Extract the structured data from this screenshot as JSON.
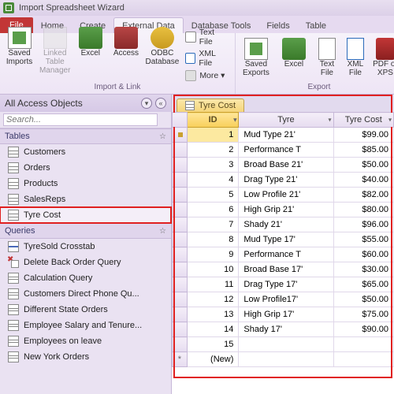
{
  "title": "Import Spreadsheet Wizard",
  "tabs": {
    "file": "File",
    "home": "Home",
    "create": "Create",
    "external": "External Data",
    "dbtools": "Database Tools",
    "fields": "Fields",
    "table": "Table"
  },
  "ribbon": {
    "import_group_label": "Import & Link",
    "export_group_label": "Export",
    "saved_imports": "Saved\nImports",
    "linked_mgr": "Linked Table\nManager",
    "excel": "Excel",
    "access": "Access",
    "odbc": "ODBC\nDatabase",
    "textfile": "Text File",
    "xmlfile": "XML File",
    "more": "More ▾",
    "saved_exports": "Saved\nExports",
    "excel2": "Excel",
    "textfile2": "Text\nFile",
    "xmlfile2": "XML\nFile",
    "pdfxps": "PDF\nor XPS"
  },
  "nav": {
    "header": "All Access Objects",
    "search_ph": "Search...",
    "tables_label": "Tables",
    "queries_label": "Queries",
    "tables": [
      "Customers",
      "Orders",
      "Products",
      "SalesReps",
      "Tyre Cost"
    ],
    "queries": [
      "TyreSold Crosstab",
      "Delete Back Order Query",
      "Calculation Query",
      "Customers Direct Phone Qu...",
      "Different State Orders",
      "Employee Salary and Tenure...",
      "Employees on leave",
      "New York Orders"
    ]
  },
  "datasheet": {
    "tab_label": "Tyre Cost",
    "cols": {
      "id": "ID",
      "tyre": "Tyre",
      "cost": "Tyre Cost"
    },
    "rows": [
      {
        "id": 1,
        "tyre": "Mud Type 21'",
        "cost": "$99.00"
      },
      {
        "id": 2,
        "tyre": "Performance T",
        "cost": "$85.00"
      },
      {
        "id": 3,
        "tyre": "Broad Base 21'",
        "cost": "$50.00"
      },
      {
        "id": 4,
        "tyre": "Drag Type 21'",
        "cost": "$40.00"
      },
      {
        "id": 5,
        "tyre": "Low Profile 21'",
        "cost": "$82.00"
      },
      {
        "id": 6,
        "tyre": "High Grip 21'",
        "cost": "$80.00"
      },
      {
        "id": 7,
        "tyre": "Shady 21'",
        "cost": "$96.00"
      },
      {
        "id": 8,
        "tyre": "Mud Type 17'",
        "cost": "$55.00"
      },
      {
        "id": 9,
        "tyre": "Performance T",
        "cost": "$60.00"
      },
      {
        "id": 10,
        "tyre": "Broad Base 17'",
        "cost": "$30.00"
      },
      {
        "id": 11,
        "tyre": "Drag Type 17'",
        "cost": "$65.00"
      },
      {
        "id": 12,
        "tyre": "Low Profile17'",
        "cost": "$50.00"
      },
      {
        "id": 13,
        "tyre": "High Grip 17'",
        "cost": "$75.00"
      },
      {
        "id": 14,
        "tyre": "Shady 17'",
        "cost": "$90.00"
      }
    ],
    "extra_id": "15",
    "new_row": "(New)",
    "star": "*"
  }
}
